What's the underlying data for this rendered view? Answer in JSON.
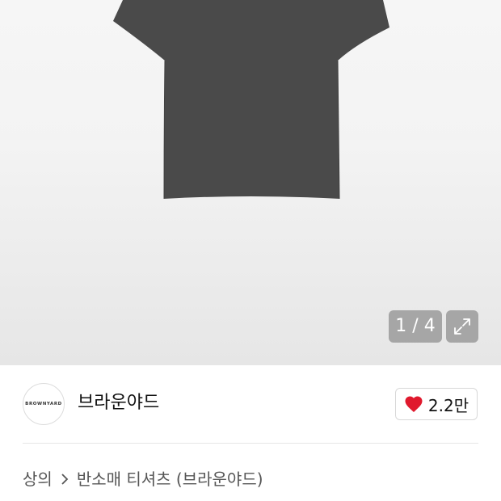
{
  "gallery": {
    "current_index": "1 / 4",
    "expand_icon": "expand-icon",
    "background_color": "#f3f3f3"
  },
  "brand": {
    "logo_text": "BROWNYARD",
    "name": "브라운야드"
  },
  "like": {
    "icon": "heart-icon",
    "color": "#e0192d",
    "count": "2.2만"
  },
  "breadcrumb": {
    "category": "상의",
    "separator_icon": "chevron-right-icon",
    "subcategory": "반소매 티셔츠 (브라운야드)"
  }
}
